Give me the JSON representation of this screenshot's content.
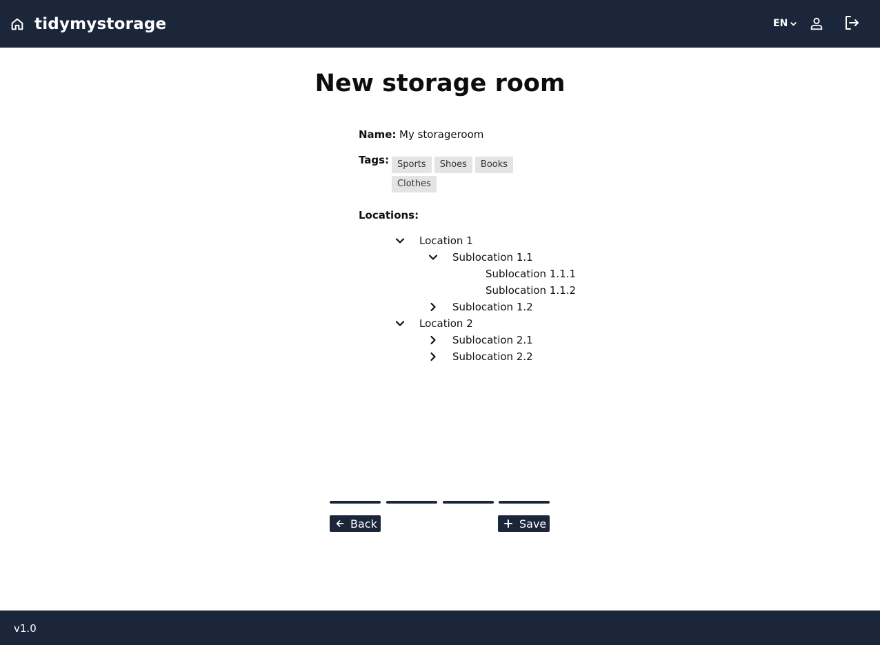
{
  "header": {
    "brand": "tidymystorage",
    "language": "EN",
    "home_icon": "home-icon",
    "user_icon": "user-icon",
    "logout_icon": "logout-icon"
  },
  "page": {
    "title": "New storage room"
  },
  "form": {
    "name_label": "Name:",
    "name_value": "My storageroom",
    "tags_label": "Tags:",
    "tags": [
      "Sports",
      "Shoes",
      "Books",
      "Clothes"
    ],
    "locations_label": "Locations:"
  },
  "locations": [
    {
      "label": "Location 1",
      "expanded": true
    },
    {
      "label": "Sublocation 1.1",
      "expanded": true
    },
    {
      "label": "Sublocation 1.1.1"
    },
    {
      "label": "Sublocation 1.1.2"
    },
    {
      "label": "Sublocation 1.2",
      "expanded": false
    },
    {
      "label": "Location 2",
      "expanded": true
    },
    {
      "label": "Sublocation 2.1",
      "expanded": false
    },
    {
      "label": "Sublocation 2.2",
      "expanded": false
    }
  ],
  "steps": {
    "total": 4,
    "completed": 4
  },
  "actions": {
    "back_label": "Back",
    "save_label": "Save"
  },
  "footer": {
    "version": "v1.0"
  },
  "colors": {
    "navbar": "#1c263b",
    "tag_background": "#e4e4e4"
  }
}
